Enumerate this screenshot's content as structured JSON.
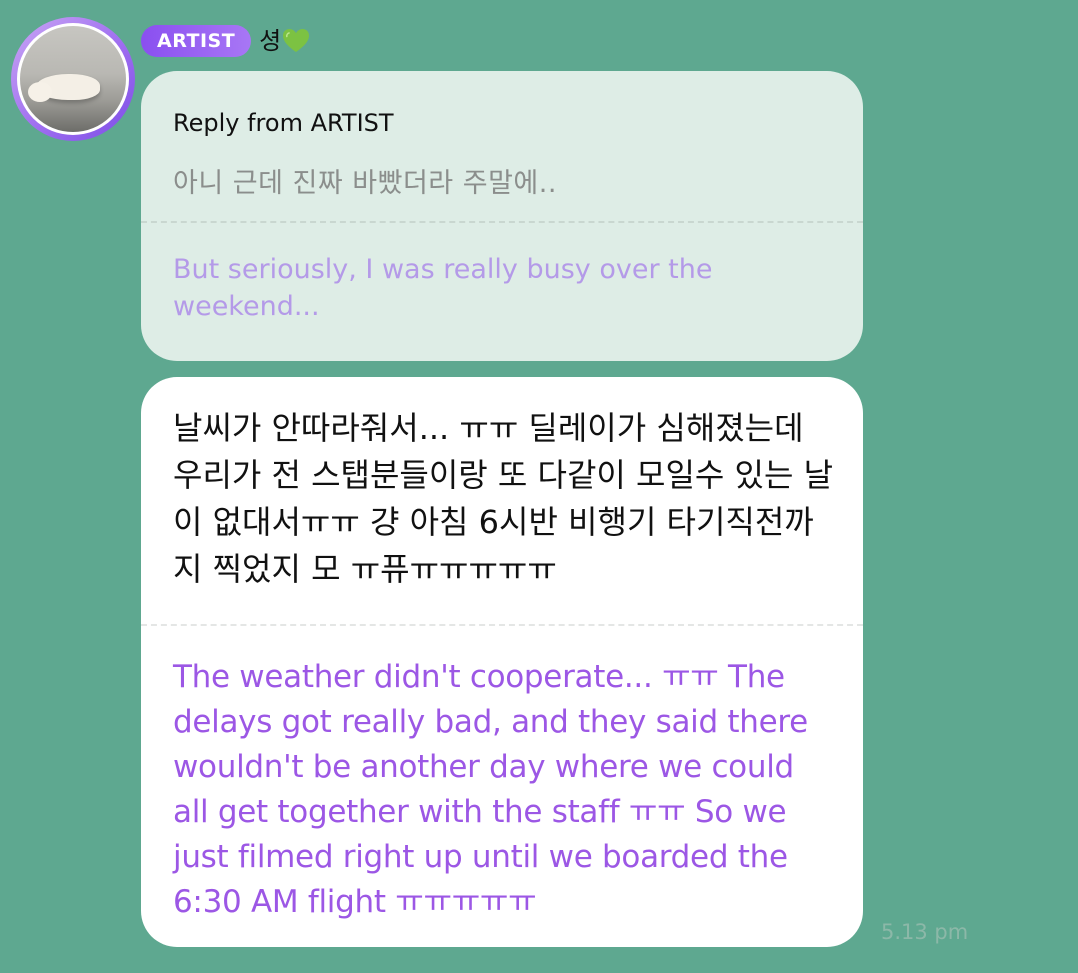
{
  "sender": {
    "badge": "ARTIST",
    "name": "셩",
    "name_emoji_icon": "green-heart-icon"
  },
  "reply": {
    "title": "Reply from ARTIST",
    "original": "아니 근데 진짜 바빴더라 주말에..",
    "translation": "But seriously, I was really busy over the weekend..."
  },
  "message": {
    "original": "날씨가 안따라줘서... ㅠㅠ 딜레이가 심해졌는데 우리가 전 스탭분들이랑 또 다같이 모일수 있는 날이 없대서ㅠㅠ 걍 아침 6시반 비행기 타기직전까지 찍었지 모 ㅠ퓨ㅠㅠㅠㅠㅠ",
    "translation": "The weather didn't cooperate... ㅠㅠ The delays got really bad, and they said there wouldn't be another day where we could all get together with the staff ㅠㅠ So we just filmed right up until we boarded the 6:30 AM flight ㅠㅠㅠㅠㅠ",
    "timestamp": "5.13 pm"
  },
  "colors": {
    "background": "#5ea890",
    "reply_bubble": "#deede6",
    "message_bubble": "#ffffff",
    "translation_text": "#9c57e5",
    "badge": "#8a4ff0"
  }
}
